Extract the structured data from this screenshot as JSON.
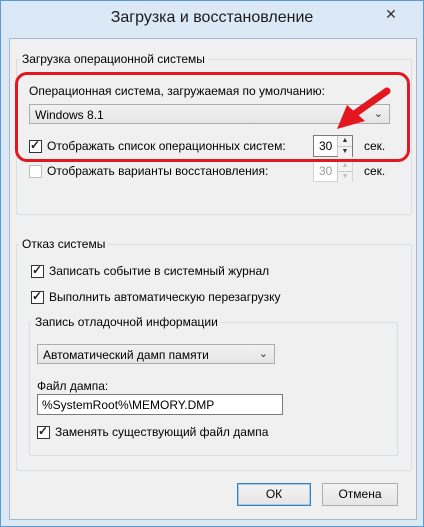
{
  "window": {
    "title": "Загрузка и восстановление",
    "close_glyph": "✕"
  },
  "startup": {
    "group_label": "Загрузка операционной системы",
    "default_os_label": "Операционная система, загружаемая по умолчанию:",
    "default_os_value": "Windows 8.1",
    "show_os_list": {
      "label": "Отображать список операционных систем:",
      "checked": true,
      "seconds": "30",
      "unit": "сек."
    },
    "show_recovery": {
      "label": "Отображать варианты восстановления:",
      "checked": false,
      "seconds": "30",
      "unit": "сек."
    }
  },
  "failure": {
    "group_label": "Отказ системы",
    "write_event": {
      "label": "Записать событие в системный журнал",
      "checked": true
    },
    "auto_restart": {
      "label": "Выполнить автоматическую перезагрузку",
      "checked": true
    },
    "debug": {
      "group_label": "Запись отладочной информации",
      "dump_type_value": "Автоматический дамп памяти",
      "dump_file_label": "Файл дампа:",
      "dump_file_value": "%SystemRoot%\\MEMORY.DMP",
      "overwrite": {
        "label": "Заменять существующий файл дампа",
        "checked": true
      }
    }
  },
  "buttons": {
    "ok": "ОК",
    "cancel": "Отмена"
  },
  "colors": {
    "highlight": "#e3171f",
    "titlebar": "#dbe9f7"
  },
  "icons": {
    "dropdown": "chevron-down-icon",
    "spin_up": "▲",
    "spin_down": "▼",
    "arrow": "red-pointer-arrow"
  }
}
